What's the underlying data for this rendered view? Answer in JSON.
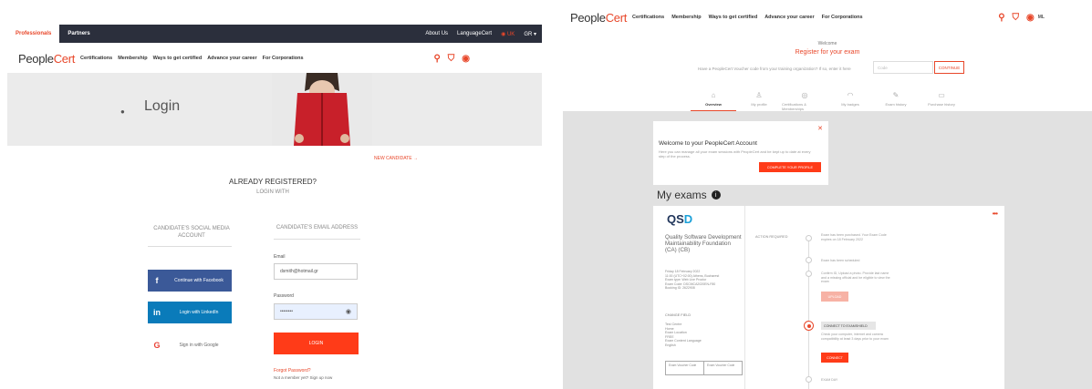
{
  "left": {
    "topbar": {
      "tab_active": "Professionals",
      "tab_other": "Partners",
      "about": "About Us",
      "languagecert": "LanguageCert",
      "lang": "UK",
      "currency": "GR"
    },
    "logo": {
      "people": "People",
      "cert": "Cert"
    },
    "nav": [
      "Certifications",
      "Membership",
      "Ways to get certified",
      "Advance your career",
      "For Corporations"
    ],
    "hero": {
      "title": "Login"
    },
    "new_link": "NEW CANDIDATE",
    "already": "ALREADY REGISTERED?",
    "login_with": "LOGIN WITH",
    "social_heading": "CANDIDATE'S SOCIAL MEDIA ACCOUNT",
    "email_heading": "CANDIDATE'S EMAIL ADDRESS",
    "social": {
      "facebook": "Continue with Facebook",
      "linkedin": "Login with LinkedIn",
      "google": "Sign in with Google"
    },
    "form": {
      "email_label": "Email",
      "email_value": "dsmith@hotmail.gr",
      "password_label": "Password",
      "password_value": "••••••••",
      "login_button": "LOGIN",
      "forgot": "Forgot Password?",
      "not_member": "Not a member yet? Sign up now"
    }
  },
  "right": {
    "logo": {
      "people": "People",
      "cert": "Cert"
    },
    "nav": [
      "Certifications",
      "Membership",
      "Ways to get certified",
      "Advance your career",
      "For Corporations"
    ],
    "user": "ML",
    "welcome": "Welcome",
    "register": "Register for your exam",
    "voucher_text": "Have a PeopleCert Voucher code from your training organization? If so, enter it here",
    "voucher_placeholder": "Code",
    "voucher_button": "CONTINUE",
    "tabs": [
      {
        "label": "Overview",
        "icon": "⌂"
      },
      {
        "label": "My profile",
        "icon": "♙"
      },
      {
        "label": "Certifications & Memberships",
        "icon": "◎"
      },
      {
        "label": "My badges",
        "icon": "◠"
      },
      {
        "label": "Exam history",
        "icon": "✎"
      },
      {
        "label": "Purchase history",
        "icon": "▭"
      }
    ],
    "welcome_card": {
      "title": "Welcome to your PeopleCert Account",
      "desc": "Here you can manage all your exam sessions with PeopleCert and be kept up to date at every step of the process.",
      "button": "COMPLETE YOUR PROFILE"
    },
    "my_exams": "My exams",
    "exam": {
      "logo_q": "QS",
      "logo_d": "D",
      "title": "Quality Software Development Maintainability Foundation (CA) (CB)",
      "info": "Friday 18 February 2022\n11:00 (UTC+02:00) Athens, Bucharest\nExam type: Web Live Proctor\nExam Code: DSCMCA2020EN-F80\nBooking ID: 2622908",
      "change": "Change field",
      "change_info": "Test Centre\nHome\nExam Location\nFREE\nExam Content Language\nEnglish",
      "box1": "Exam Voucher Code",
      "box2": "Exam Voucher Code",
      "action_required": "ACTION REQUIRED",
      "steps": [
        "Exam has been purchased. Your Exam Code expires on 18 February 2022",
        "Exam has been scheduled",
        "Confirm ID, Upload a photo. Provide last name and a missing official and be eligible to view the exam"
      ],
      "step_button_1": "UPLOAD",
      "active_step": "CONNECT TO EXAMSHIELD",
      "active_text": "Check your computer, internet and camera compatibility at least 3 days prior to your exam",
      "active_button": "CONNECT",
      "last_step": "EXAM DAY"
    }
  }
}
